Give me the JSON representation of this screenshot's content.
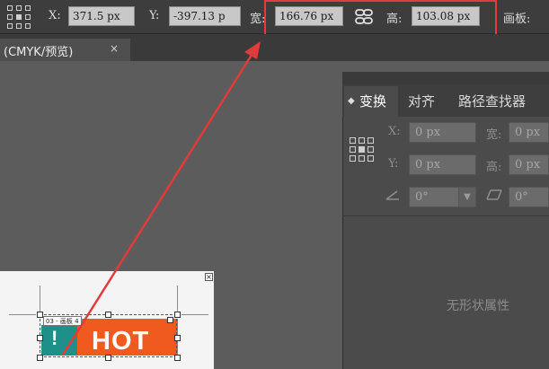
{
  "control_bar": {
    "x_label": "X:",
    "x_value": "371.5 px",
    "y_label": "Y:",
    "y_value": "-397.13 p",
    "width_label": "宽:",
    "width_value": "166.76 px",
    "height_label": "高:",
    "height_value": "103.08 px",
    "artboard_label": "画板:",
    "link_icon": "link-proportions-icon",
    "highlight_color": "#e23b3b"
  },
  "document_tab": {
    "title": "(CMYK/预览)",
    "close": "×"
  },
  "panel": {
    "tabs": [
      "变换",
      "对齐",
      "路径查找器"
    ],
    "active_tab": "变换",
    "x_label": "X:",
    "x_value": "0 px",
    "y_label": "Y:",
    "y_value": "0 px",
    "width_label": "宽:",
    "width_value": "0 px",
    "height_label": "高:",
    "height_value": "0 px",
    "rotate_value": "0°",
    "shear_value": "0°",
    "empty_message": "无形状属性"
  },
  "artboard": {
    "label": "03 - 画板 4",
    "close": "×",
    "hot_text": "HOT",
    "badge_text": "!",
    "badge_color": "#1f8f8a",
    "hot_color": "#f05a1e"
  }
}
